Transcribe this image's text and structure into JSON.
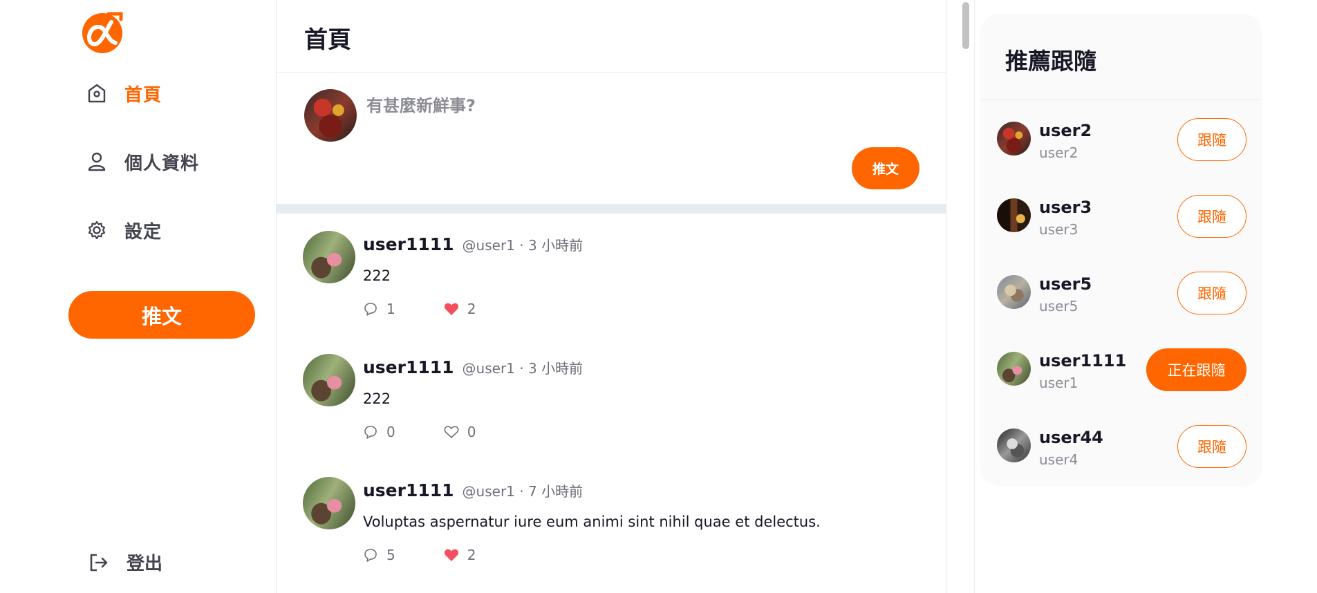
{
  "brand": {
    "accent": "#ff6600",
    "logo_icon": "alpha-logo-icon"
  },
  "nav": {
    "items": [
      {
        "label": "首頁",
        "icon": "home-icon",
        "active": true
      },
      {
        "label": "個人資料",
        "icon": "user-icon",
        "active": false
      },
      {
        "label": "設定",
        "icon": "gear-icon",
        "active": false
      }
    ],
    "tweet_button": "推文",
    "logout_label": "登出"
  },
  "main": {
    "title": "首頁",
    "composer": {
      "placeholder": "有甚麼新鮮事?",
      "submit_label": "推文"
    },
    "tweets": [
      {
        "name": "user1111",
        "handle": "@user1",
        "time": "3 小時前",
        "body": "222",
        "replies": "1",
        "likes": "2",
        "liked": true
      },
      {
        "name": "user1111",
        "handle": "@user1",
        "time": "3 小時前",
        "body": "222",
        "replies": "0",
        "likes": "0",
        "liked": false
      },
      {
        "name": "user1111",
        "handle": "@user1",
        "time": "7 小時前",
        "body": "Voluptas aspernatur iure eum animi sint nihil quae et delectus.",
        "replies": "5",
        "likes": "2",
        "liked": true
      }
    ]
  },
  "recommend": {
    "title": "推薦跟隨",
    "users": [
      {
        "name": "user2",
        "handle": "user2",
        "button": "跟隨",
        "following": false
      },
      {
        "name": "user3",
        "handle": "user3",
        "button": "跟隨",
        "following": false
      },
      {
        "name": "user5",
        "handle": "user5",
        "button": "跟隨",
        "following": false
      },
      {
        "name": "user1111",
        "handle": "user1",
        "button": "正在跟隨",
        "following": true
      },
      {
        "name": "user44",
        "handle": "user4",
        "button": "跟隨",
        "following": false
      }
    ]
  }
}
